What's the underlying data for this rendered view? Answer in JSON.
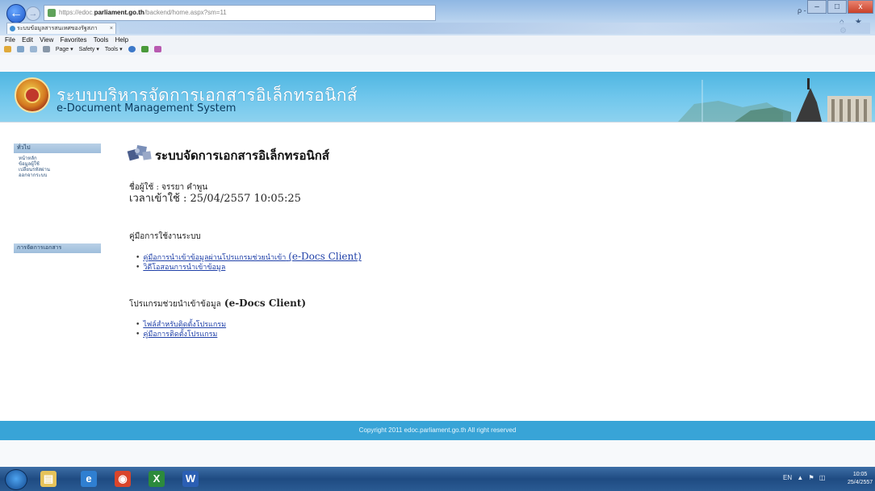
{
  "browser": {
    "url_prefix": "https://edoc.",
    "url_domain": "parliament.go.th",
    "url_path": "/backend/home.aspx?sm=11",
    "search_label": "ρ - ≙ C",
    "tab_title": "ระบบข้อมูลสารสนเทศของรัฐสภา",
    "tab_close": "×",
    "window_buttons": [
      "–",
      "□",
      "x"
    ],
    "right_icons": "⌂ ★ ⚙",
    "menu": [
      "File",
      "Edit",
      "View",
      "Favorites",
      "Tools",
      "Help"
    ],
    "command_bar": [
      "Page ▾",
      "Safety ▾",
      "Tools ▾"
    ]
  },
  "site": {
    "title_th": "ระบบบริหารจัดการเอกสารอิเล็กทรอนิกส์",
    "title_en": "e-Document Management System"
  },
  "sidebar": {
    "section1_title": "ทั่วไป",
    "links": [
      "หน้าหลัก",
      "ข้อมูลผู้ใช้",
      "เปลี่ยนรหัสผ่าน",
      "ออกจากระบบ"
    ],
    "section2_title": "การจัดการเอกสาร"
  },
  "main": {
    "heading": "ระบบจัดการเอกสารอิเล็กทรอนิกส์",
    "user_label": "ชื่อผู้ใช้ : จรรยา คำพูน",
    "login_time": "เวลาเข้าใช้ : 25/04/2557 10:05:25",
    "manual_title": "คู่มือการใช้งานระบบ",
    "manual_items": [
      {
        "label": "คู่มือการนำเข้าข้อมูลผ่านโปรแกรมช่วยนำเข้า",
        "suffix": "(e-Docs Client)"
      },
      {
        "label": "วิดีโอสอนการนำเข้าข้อมูล",
        "suffix": ""
      }
    ],
    "client_title_th": "โปรแกรมช่วยนำเข้าข้อมูล",
    "client_title_en": "(e-Docs Client)",
    "client_items": [
      "ไฟล์สำหรับติดตั้งโปรแกรม",
      "คู่มือการติดตั้งโปรแกรม"
    ]
  },
  "footer": {
    "copyright": "Copyright 2011 edoc.parliament.go.th All right reserved"
  },
  "taskbar": {
    "apps": [
      {
        "name": "explorer",
        "color": "#e6c35a",
        "glyph": "▤"
      },
      {
        "name": "ie",
        "color": "#2f7fd1",
        "glyph": "e"
      },
      {
        "name": "chrome",
        "color": "#d9452b",
        "glyph": "◉"
      },
      {
        "name": "excel",
        "color": "#2c8a3c",
        "glyph": "X"
      },
      {
        "name": "word",
        "color": "#2b5fb4",
        "glyph": "W"
      }
    ],
    "tray": "EN ▲ ⚑ ◫",
    "time": "10:05",
    "date": "25/4/2557"
  }
}
